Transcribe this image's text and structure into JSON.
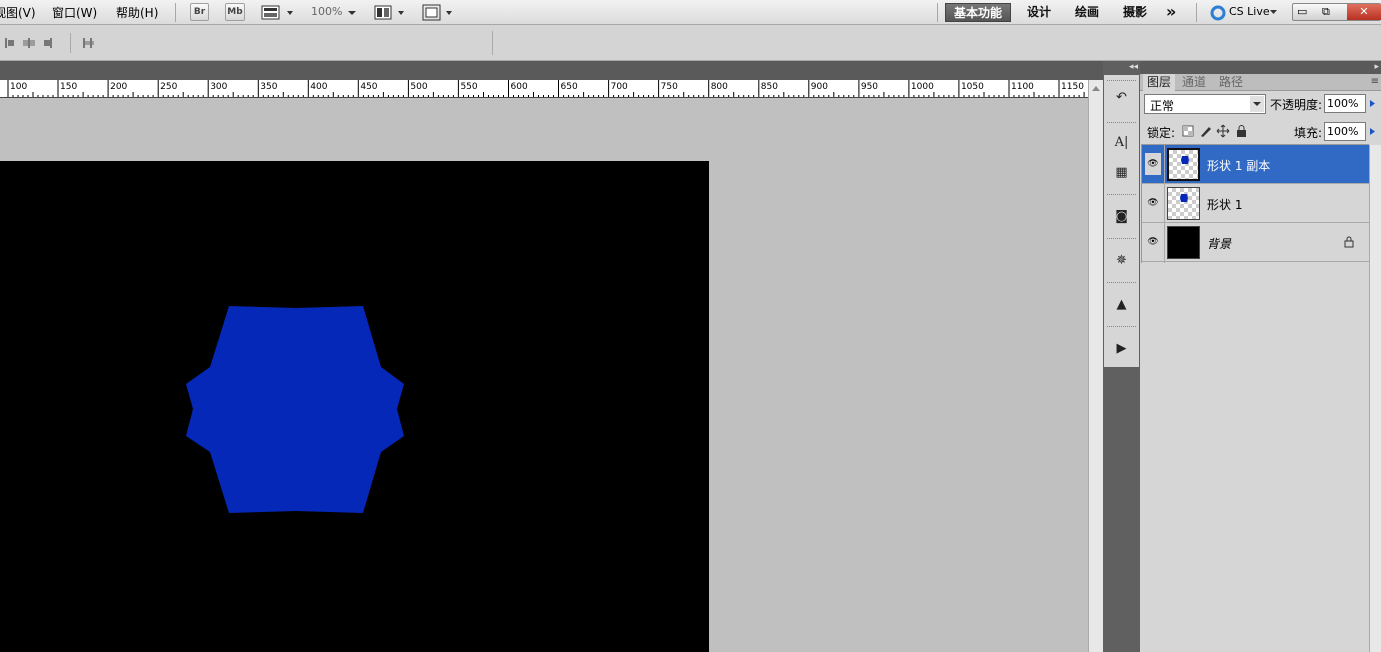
{
  "menu": {
    "items": [
      {
        "label": "视图(V)"
      },
      {
        "label": "窗口(W)"
      },
      {
        "label": "帮助(H)"
      }
    ],
    "bridge_label": "Br",
    "minibridge_label": "Mb",
    "zoom": "100%"
  },
  "workspaces": {
    "active": "基本功能",
    "items": [
      "设计",
      "绘画",
      "摄影"
    ],
    "more": "»",
    "cslive": "CS Live"
  },
  "window_controls": {
    "minimize": "▭",
    "restore": "⧉",
    "close": "✕"
  },
  "ruler": {
    "labels": [
      "100",
      "150",
      "200",
      "250",
      "300",
      "350",
      "400",
      "450",
      "500",
      "550",
      "600",
      "650",
      "700",
      "750",
      "800",
      "850",
      "900",
      "950",
      "1000",
      "1050",
      "1100",
      "1150"
    ]
  },
  "layers_panel": {
    "tabs": [
      "图层",
      "通道",
      "路径"
    ],
    "blend_mode": "正常",
    "opacity_label": "不透明度:",
    "opacity_value": "100%",
    "lock_label": "锁定:",
    "fill_label": "填充:",
    "fill_value": "100%",
    "layers": [
      {
        "name": "形状 1 副本",
        "selected": true
      },
      {
        "name": "形状 1",
        "selected": false
      },
      {
        "name": "背景",
        "selected": false,
        "locked": true
      }
    ]
  },
  "colors": {
    "shape": "#0528b8",
    "selection": "#316ac5",
    "document_bg": "#000000"
  }
}
